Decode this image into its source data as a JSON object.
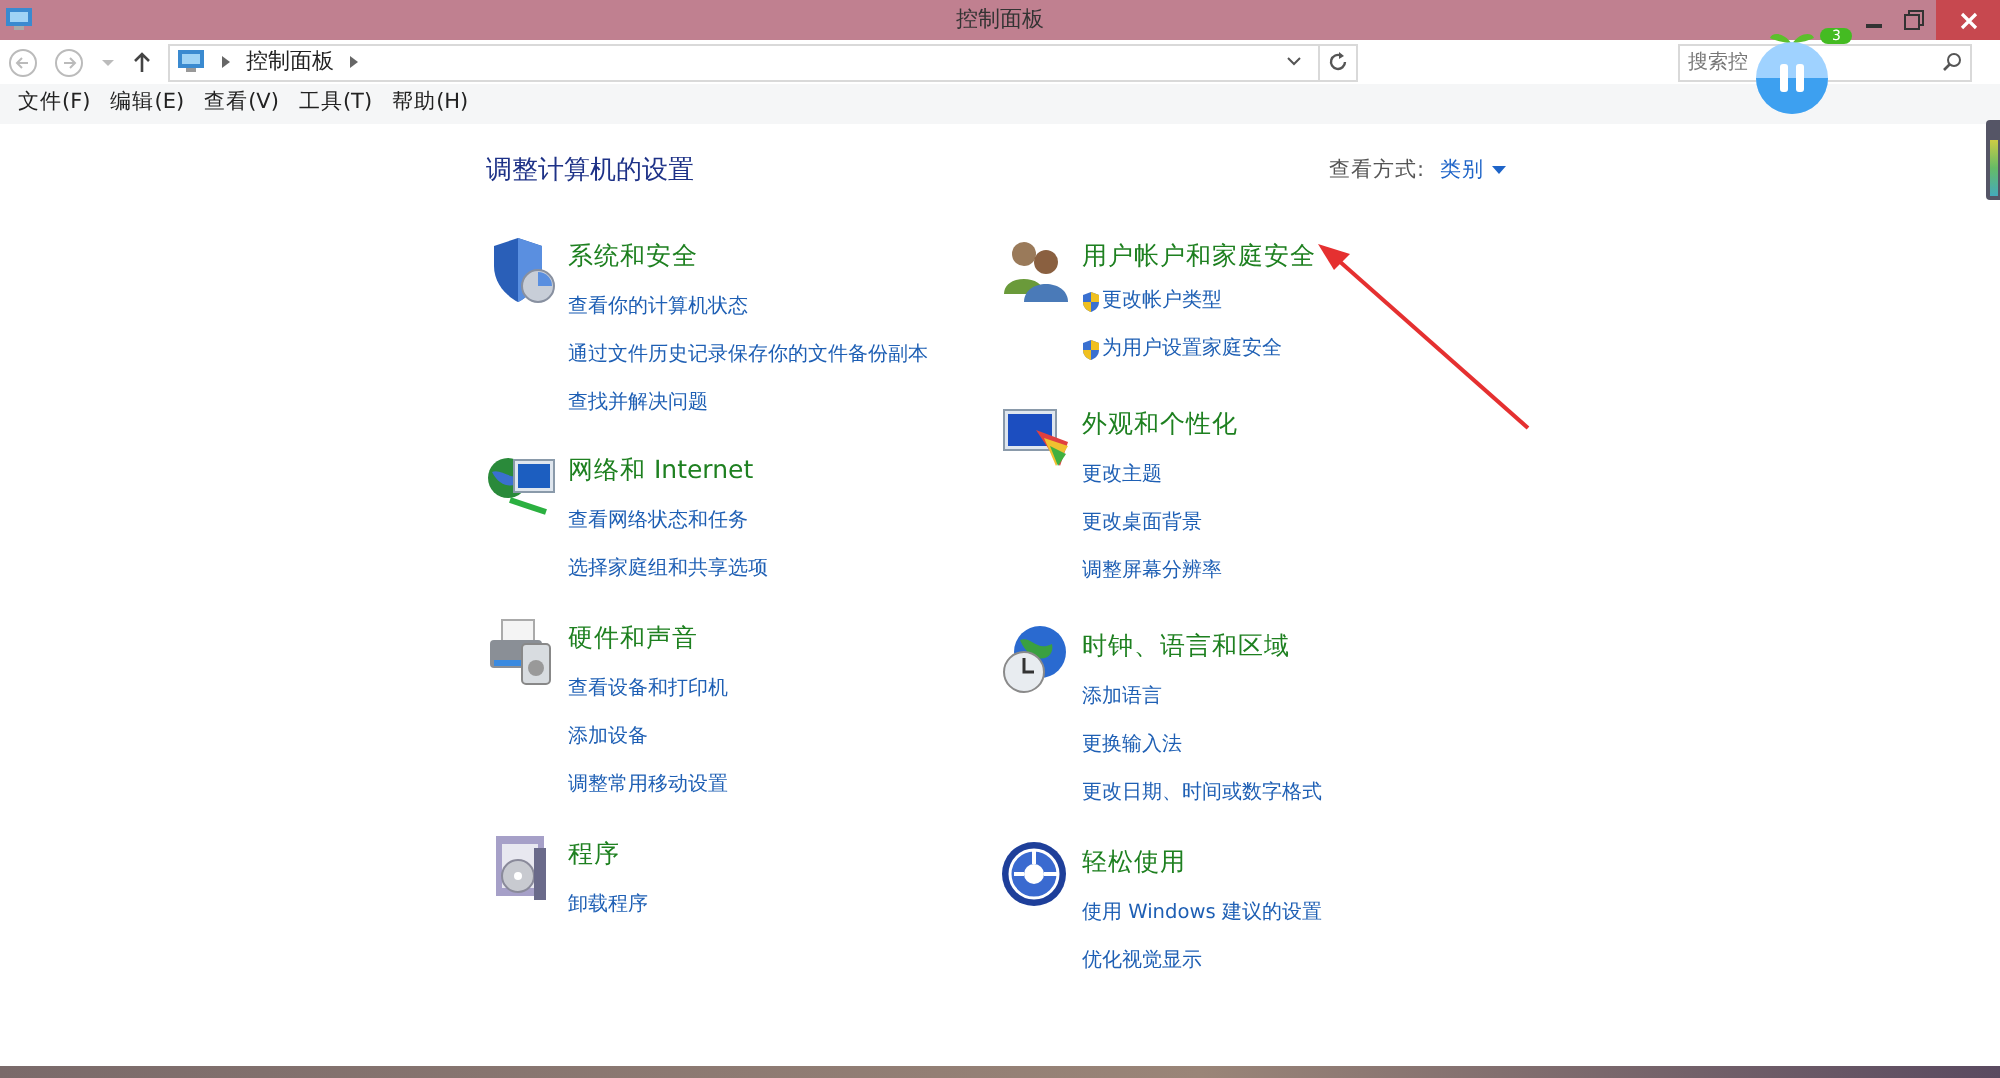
{
  "window": {
    "title": "控制面板"
  },
  "address_bar": {
    "path": [
      "控制面板"
    ]
  },
  "search": {
    "placeholder": "搜索控"
  },
  "menu": [
    "文件(F)",
    "编辑(E)",
    "查看(V)",
    "工具(T)",
    "帮助(H)"
  ],
  "heading": "调整计算机的设置",
  "view_by": {
    "label": "查看方式:",
    "value": "类别"
  },
  "columns": [
    [
      {
        "kind": "security",
        "title": "系统和安全",
        "links": [
          {
            "text": "查看你的计算机状态",
            "shield": false
          },
          {
            "text": "通过文件历史记录保存你的文件备份副本",
            "shield": false
          },
          {
            "text": "查找并解决问题",
            "shield": false
          }
        ]
      },
      {
        "kind": "network",
        "title": "网络和 Internet",
        "links": [
          {
            "text": "查看网络状态和任务",
            "shield": false
          },
          {
            "text": "选择家庭组和共享选项",
            "shield": false
          }
        ]
      },
      {
        "kind": "hardware",
        "title": "硬件和声音",
        "links": [
          {
            "text": "查看设备和打印机",
            "shield": false
          },
          {
            "text": "添加设备",
            "shield": false
          },
          {
            "text": "调整常用移动设置",
            "shield": false
          }
        ]
      },
      {
        "kind": "programs",
        "title": "程序",
        "links": [
          {
            "text": "卸载程序",
            "shield": false
          }
        ]
      }
    ],
    [
      {
        "kind": "users",
        "title": "用户帐户和家庭安全",
        "links": [
          {
            "text": "更改帐户类型",
            "shield": true
          },
          {
            "text": "为用户设置家庭安全",
            "shield": true
          }
        ]
      },
      {
        "kind": "appearance",
        "title": "外观和个性化",
        "links": [
          {
            "text": "更改主题",
            "shield": false
          },
          {
            "text": "更改桌面背景",
            "shield": false
          },
          {
            "text": "调整屏幕分辨率",
            "shield": false
          }
        ]
      },
      {
        "kind": "clock",
        "title": "时钟、语言和区域",
        "links": [
          {
            "text": "添加语言",
            "shield": false
          },
          {
            "text": "更换输入法",
            "shield": false
          },
          {
            "text": "更改日期、时间或数字格式",
            "shield": false
          }
        ]
      },
      {
        "kind": "ease",
        "title": "轻松使用",
        "links": [
          {
            "text": "使用 Windows 建议的设置",
            "shield": false
          },
          {
            "text": "优化视觉显示",
            "shield": false
          }
        ]
      }
    ]
  ],
  "floating_widget": {
    "badge": "3"
  }
}
